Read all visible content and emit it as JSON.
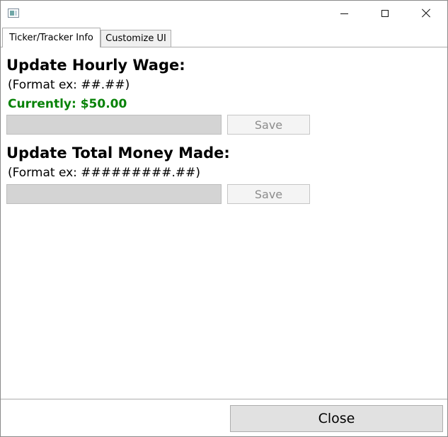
{
  "window": {
    "icon": "app-window-icon"
  },
  "tabs": [
    {
      "label": "Ticker/Tracker Info",
      "active": true
    },
    {
      "label": "Customize UI",
      "active": false
    }
  ],
  "hourly_wage": {
    "heading": "Update Hourly Wage:",
    "format_hint": "(Format ex: ##.##)",
    "current": "Currently: $50.00",
    "input_value": "",
    "save_label": "Save"
  },
  "total_money": {
    "heading": "Update Total Money Made:",
    "format_hint": "(Format ex: #########.##)",
    "input_value": "",
    "save_label": "Save"
  },
  "footer": {
    "close_label": "Close"
  },
  "colors": {
    "current_value": "#078207",
    "input_background": "#d4d4d4",
    "disabled_text": "#8c8c8c"
  }
}
